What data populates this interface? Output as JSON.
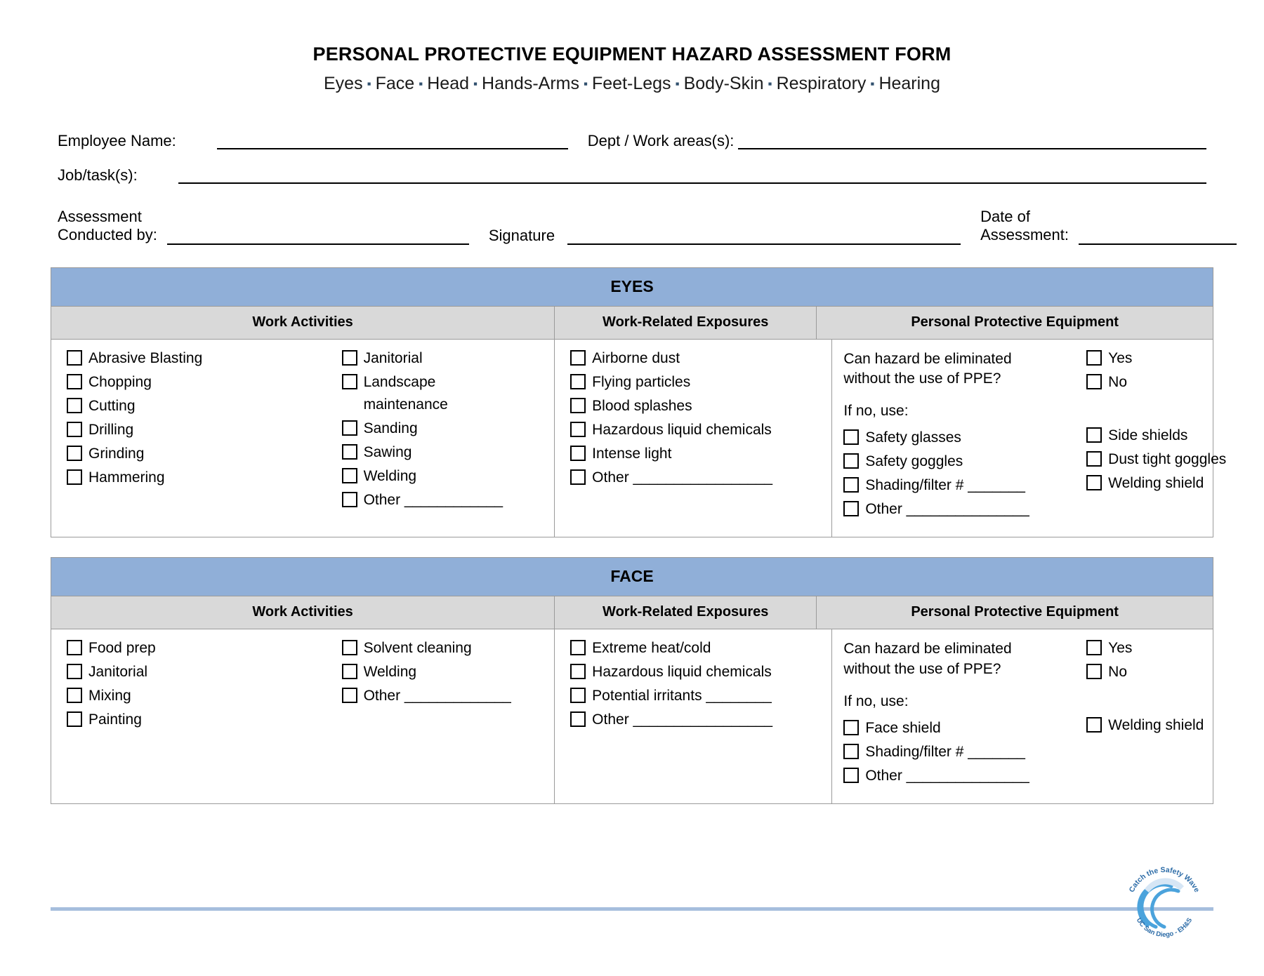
{
  "document": {
    "title": "PERSONAL PROTECTIVE EQUIPMENT HAZARD ASSESSMENT FORM",
    "subtitle_items": [
      "Eyes",
      "Face",
      "Head",
      "Hands-Arms",
      "Feet-Legs",
      "Body-Skin",
      "Respiratory",
      "Hearing"
    ],
    "separator": "▪"
  },
  "header_fields": {
    "employee_name_label": "Employee Name:",
    "employee_name_value": "",
    "dept_label": "Dept / Work areas(s):",
    "dept_value": "",
    "job_tasks_label": "Job/task(s):",
    "job_tasks_value": "",
    "assessment_conducted_by_label_line1": "Assessment",
    "assessment_conducted_by_label_line2": "Conducted by:",
    "assessment_conducted_by_value": "",
    "signature_label": "Signature",
    "signature_value": "",
    "date_of_assessment_label_line1": "Date of",
    "date_of_assessment_label_line2": "Assessment:",
    "date_of_assessment_value": ""
  },
  "column_headers": {
    "work_activities": "Work Activities",
    "work_related_exposures": "Work-Related Exposures",
    "personal_protective_equipment": "Personal Protective Equipment"
  },
  "ppe_question": {
    "question_line1": "Can hazard be eliminated",
    "question_line2": "without the use of PPE?",
    "if_no_label": "If no, use:",
    "yes_label": "Yes",
    "no_label": "No"
  },
  "sections": [
    {
      "name": "EYES",
      "activities_left": [
        "Abrasive Blasting",
        "Chopping",
        "Cutting",
        "Drilling",
        "Grinding",
        "Hammering"
      ],
      "activities_right": [
        "Janitorial",
        "Landscape",
        "Sanding",
        "Sawing",
        "Welding",
        "Other ____________"
      ],
      "activities_right_continuation": "maintenance",
      "exposures": [
        "Airborne dust",
        "Flying particles",
        "Blood splashes",
        "Hazardous liquid chemicals",
        "Intense light",
        "Other _________________"
      ],
      "ppe_left": [
        "Safety glasses",
        "Safety goggles",
        "Shading/filter # _______",
        "Other _______________"
      ],
      "ppe_right": [
        "Side shields",
        "Dust tight goggles",
        "Welding shield"
      ]
    },
    {
      "name": "FACE",
      "activities_left": [
        "Food prep",
        "Janitorial",
        "Mixing",
        "Painting"
      ],
      "activities_right": [
        "Solvent cleaning",
        "Welding",
        "Other _____________"
      ],
      "activities_right_continuation": "",
      "exposures": [
        "Extreme heat/cold",
        "Hazardous liquid chemicals",
        "Potential irritants ________",
        "Other _________________"
      ],
      "ppe_left": [
        "Face shield",
        "Shading/filter # _______",
        "Other _______________"
      ],
      "ppe_right": [
        "Welding shield"
      ]
    }
  ],
  "footer": {
    "logo_tagline": "Catch the Safety Wave",
    "logo_org": "UC San Diego - EH&S"
  },
  "colors": {
    "section_header_blue": "#90AFD8",
    "column_header_gray": "#D9D9D9",
    "footer_rule_blue": "#A6BEDD",
    "logo_blue": "#4BA3DC"
  }
}
